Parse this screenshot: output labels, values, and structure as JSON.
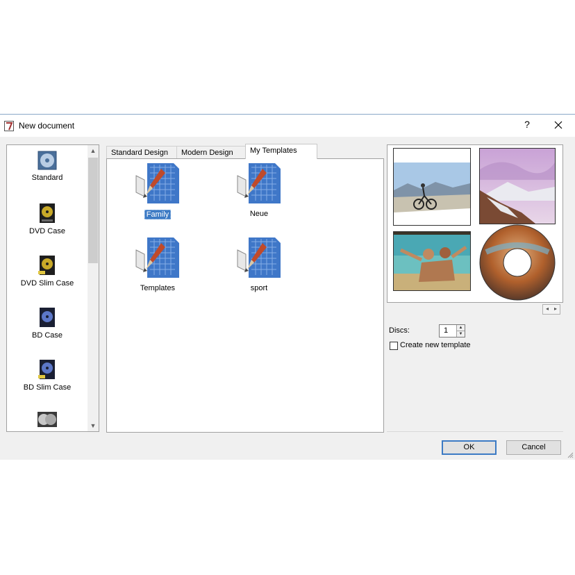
{
  "window": {
    "title": "New document",
    "help_label": "?"
  },
  "document_types": [
    {
      "label": "Standard",
      "icon": "standard-disc-icon"
    },
    {
      "label": "DVD Case",
      "icon": "dvd-case-icon"
    },
    {
      "label": "DVD Slim Case",
      "icon": "dvd-slim-case-icon"
    },
    {
      "label": "BD Case",
      "icon": "bd-case-icon"
    },
    {
      "label": "BD Slim Case",
      "icon": "bd-slim-case-icon"
    },
    {
      "label": "",
      "icon": "multi-disc-case-icon"
    }
  ],
  "tabs": [
    {
      "label": "Standard Design"
    },
    {
      "label": "Modern Design"
    },
    {
      "label": "My Templates",
      "active": true
    }
  ],
  "templates": [
    {
      "label": "Family",
      "selected": true
    },
    {
      "label": "Neue"
    },
    {
      "label": "Templates"
    },
    {
      "label": "sport"
    }
  ],
  "preview": {
    "thumbnails": [
      "cyclist-mountains",
      "snowy-mountain-sunset",
      "beach-couple",
      "canyon-disc"
    ]
  },
  "options": {
    "discs_label": "Discs:",
    "discs_value": "1",
    "create_template_label": "Create new template",
    "create_template_checked": false
  },
  "buttons": {
    "ok": "OK",
    "cancel": "Cancel"
  },
  "colors": {
    "selection": "#3c7ac4",
    "dialog_bg": "#f0f0f0"
  }
}
